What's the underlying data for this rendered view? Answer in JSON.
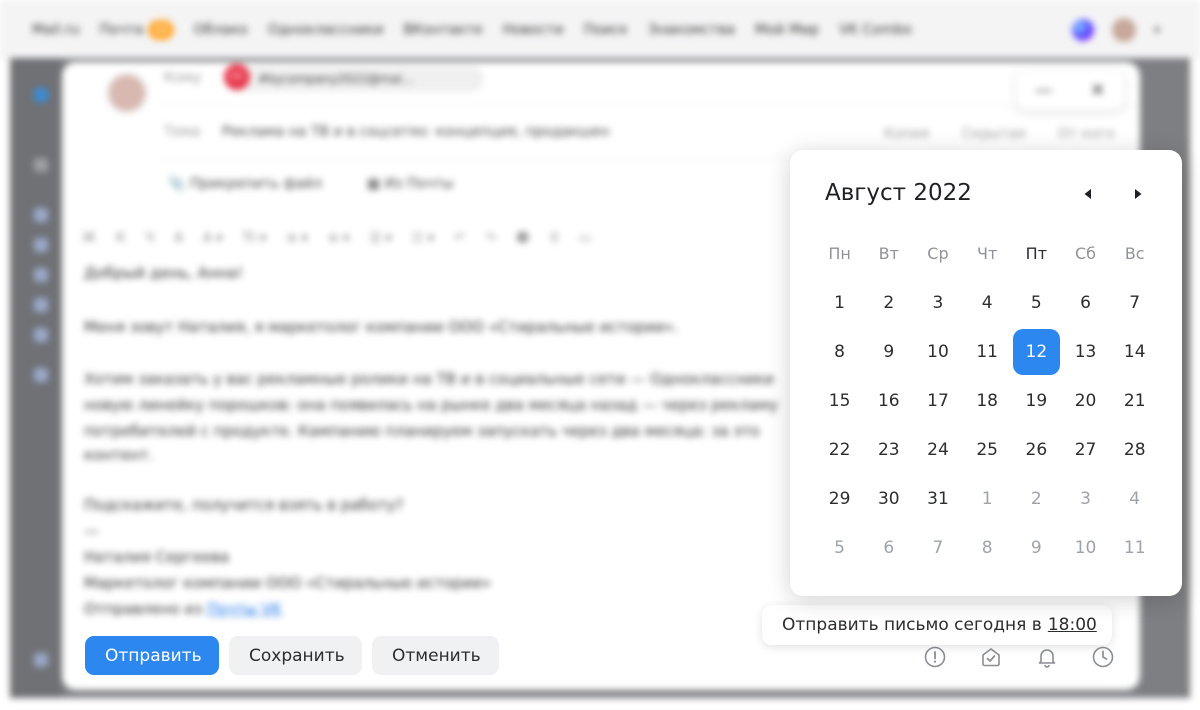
{
  "topnav": {
    "links": [
      "Mail.ru",
      "Почта",
      "Облако",
      "Одноклассники",
      "ВКонтакте",
      "Новости",
      "Поиск",
      "Знакомства",
      "Мой Мир",
      "VK Combo"
    ],
    "mail_badge": "12"
  },
  "compose": {
    "from_label": "Кому",
    "to_address": "#kycompany2022@mai...",
    "to_avatar_initials": "ОС",
    "subject_label": "Тема",
    "subject_value": "Реклама на ТВ и в соцсетях: концепция, продакшен",
    "copy_links": [
      "Копия",
      "Скрытая",
      "От кого"
    ],
    "attach_label": "Прикрепить файл",
    "from_mail_label": "Из Почты",
    "window_minimize": "—",
    "window_close": "✕",
    "format_items": [
      "Ж",
      "К",
      "Ч",
      "A",
      "A ▾",
      "Tt ▾",
      "≡ ▾",
      "≡ ▾",
      "☰ ▾",
      "☷ ▾",
      "↶",
      "↷",
      "☻",
      "⚲",
      "▭"
    ],
    "body_lines": [
      "Добрый день, Анна!",
      "Меня зовут Наталия, я маркетолог компании ООО «Стиральные истории».",
      "Хотим заказать у вас рекламные ролики на ТВ и в социальные сети — Одноклассники",
      "новую линейку порошков: она появилась на рынке два месяца назад — через рекламу",
      "потребителей с продукте. Кампанию планируем запускать через два месяца: за это",
      "контент.",
      "Подскажите, получится взять в работу?",
      "—",
      "Наталия Сергеева",
      "Маркетолог компании ООО «Стиральные истории»"
    ],
    "sent_from_prefix": "Отправлено из",
    "sent_from_link": "Почты VK"
  },
  "footer": {
    "send_label": "Отправить",
    "save_label": "Сохранить",
    "cancel_label": "Отменить",
    "icons": [
      "important-icon",
      "notify-icon",
      "reminder-icon",
      "schedule-icon"
    ]
  },
  "schedule": {
    "text": "Отправить письмо сегодня в",
    "time": "18:00"
  },
  "calendar": {
    "month_year": "Август 2022",
    "weekdays": [
      "Пн",
      "Вт",
      "Ср",
      "Чт",
      "Пт",
      "Сб",
      "Вс"
    ],
    "weeks": [
      [
        {
          "d": "1"
        },
        {
          "d": "2"
        },
        {
          "d": "3"
        },
        {
          "d": "4"
        },
        {
          "d": "5"
        },
        {
          "d": "6"
        },
        {
          "d": "7"
        }
      ],
      [
        {
          "d": "8"
        },
        {
          "d": "9"
        },
        {
          "d": "10"
        },
        {
          "d": "11"
        },
        {
          "d": "12",
          "selected": true
        },
        {
          "d": "13"
        },
        {
          "d": "14"
        }
      ],
      [
        {
          "d": "15"
        },
        {
          "d": "16"
        },
        {
          "d": "17"
        },
        {
          "d": "18"
        },
        {
          "d": "19"
        },
        {
          "d": "20"
        },
        {
          "d": "21"
        }
      ],
      [
        {
          "d": "22"
        },
        {
          "d": "23"
        },
        {
          "d": "24"
        },
        {
          "d": "25"
        },
        {
          "d": "26"
        },
        {
          "d": "27"
        },
        {
          "d": "28"
        }
      ],
      [
        {
          "d": "29"
        },
        {
          "d": "30"
        },
        {
          "d": "31"
        },
        {
          "d": "1",
          "other": true
        },
        {
          "d": "2",
          "other": true
        },
        {
          "d": "3",
          "other": true
        },
        {
          "d": "4",
          "other": true
        }
      ],
      [
        {
          "d": "5",
          "other": true
        },
        {
          "d": "6",
          "other": true
        },
        {
          "d": "7",
          "other": true
        },
        {
          "d": "8",
          "other": true
        },
        {
          "d": "9",
          "other": true
        },
        {
          "d": "10",
          "other": true
        },
        {
          "d": "11",
          "other": true
        }
      ]
    ],
    "selected_color": "#2c87ef"
  },
  "colors": {
    "accent": "#2c87ef",
    "overlay": "#7d7f83"
  }
}
